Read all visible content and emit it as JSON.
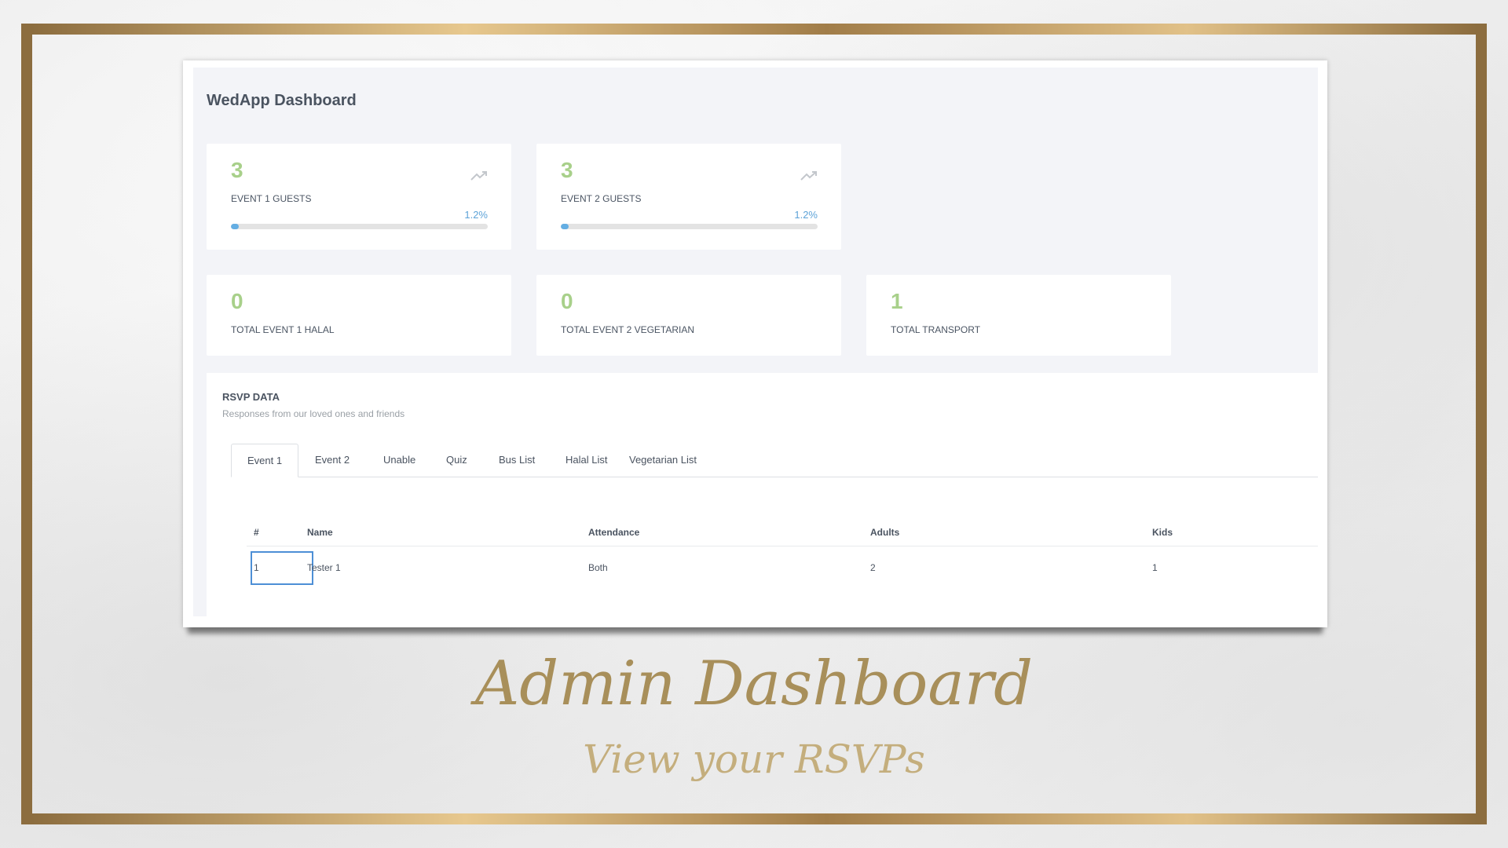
{
  "dashboard": {
    "title": "WedApp Dashboard",
    "cards_top": [
      {
        "value": "3",
        "label": "EVENT 1 GUESTS",
        "percent": "1.2%",
        "progress": 1.2,
        "trend_icon": "trending-up-icon"
      },
      {
        "value": "3",
        "label": "EVENT 2 GUESTS",
        "percent": "1.2%",
        "progress": 1.2,
        "trend_icon": "trending-up-icon"
      }
    ],
    "cards_bottom": [
      {
        "value": "0",
        "label": "TOTAL EVENT 1 HALAL"
      },
      {
        "value": "0",
        "label": "TOTAL EVENT 2 VEGETARIAN"
      },
      {
        "value": "1",
        "label": "TOTAL TRANSPORT"
      }
    ]
  },
  "rsvp": {
    "heading": "RSVP DATA",
    "subheading": "Responses from our loved ones and friends",
    "tabs": [
      {
        "label": "Event 1",
        "active": true
      },
      {
        "label": "Event 2",
        "active": false
      },
      {
        "label": "Unable",
        "active": false
      },
      {
        "label": "Quiz",
        "active": false
      },
      {
        "label": "Bus List",
        "active": false
      },
      {
        "label": "Halal List",
        "active": false
      },
      {
        "label": "Vegetarian List",
        "active": false
      }
    ],
    "columns": [
      "#",
      "Name",
      "Attendance",
      "Adults",
      "Kids"
    ],
    "rows": [
      [
        "1",
        "Tester 1",
        "Both",
        "2",
        "1"
      ]
    ]
  },
  "caption": {
    "title": "Admin Dashboard",
    "subtitle": "View your RSVPs"
  },
  "colors": {
    "accent_green": "#a8d08a",
    "accent_blue": "#64aee3",
    "gold": "#b08d57"
  }
}
